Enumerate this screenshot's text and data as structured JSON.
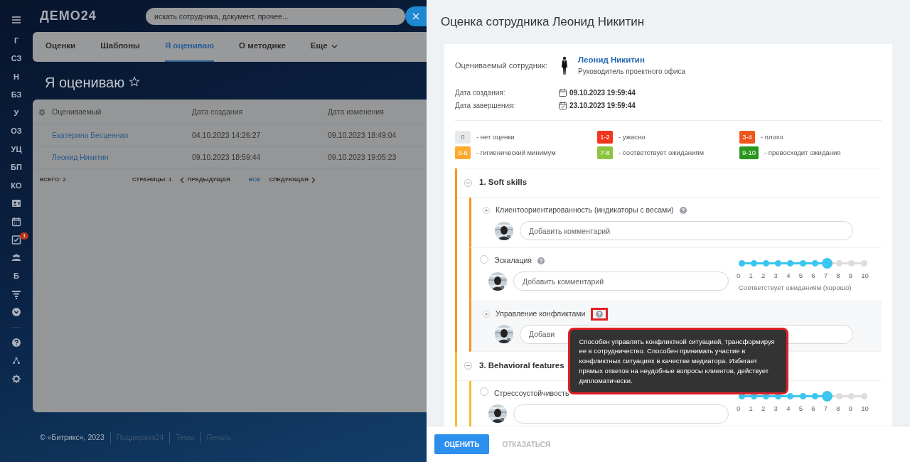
{
  "app": {
    "logo": "ДЕМО24",
    "search": {
      "placeholder": "искать сотрудника, документ, прочее..."
    }
  },
  "sidebar": [
    {
      "kind": "menu"
    },
    {
      "kind": "letter",
      "label": "Г"
    },
    {
      "kind": "letter",
      "label": "СЗ"
    },
    {
      "kind": "letter",
      "label": "Н"
    },
    {
      "kind": "letter",
      "label": "БЗ"
    },
    {
      "kind": "letter",
      "label": "У"
    },
    {
      "kind": "letter",
      "label": "ОЗ"
    },
    {
      "kind": "letter",
      "label": "УЦ"
    },
    {
      "kind": "letter",
      "label": "БП"
    },
    {
      "kind": "letter",
      "label": "КО"
    },
    {
      "kind": "icon"
    },
    {
      "kind": "icon"
    },
    {
      "kind": "icon",
      "badge": "1"
    },
    {
      "kind": "icon"
    },
    {
      "kind": "letter",
      "label": "Б"
    },
    {
      "kind": "icon"
    },
    {
      "kind": "icon"
    },
    {
      "kind": "divider"
    },
    {
      "kind": "icon"
    },
    {
      "kind": "icon"
    },
    {
      "kind": "icon"
    }
  ],
  "tabs": [
    {
      "label": "Оценки",
      "selected": false,
      "kind": "link"
    },
    {
      "label": "Шаблоны",
      "selected": false,
      "kind": "link"
    },
    {
      "label": "Я оцениваю",
      "selected": true,
      "kind": "link"
    },
    {
      "label": "О методике",
      "selected": false,
      "kind": "link"
    },
    {
      "label": "Еще",
      "selected": false,
      "kind": "dropdown"
    }
  ],
  "page_title": "Я оцениваю",
  "table": {
    "columns": [
      "Оцениваемый",
      "Дата создания",
      "Дата изменения"
    ],
    "rows": [
      {
        "cells": [
          "Екатерина Бесценная",
          "04.10.2023 14:26:27",
          "09.10.2023 18:49:04"
        ]
      },
      {
        "cells": [
          "Леонид Никитин",
          "09.10.2023 18:59:44",
          "09.10.2023 19:05:23"
        ]
      }
    ],
    "footer": {
      "total": "ВСЕГО: 2",
      "pages": "СТРАНИЦЫ: 1",
      "prev": "ПРЕДЫДУЩАЯ",
      "all": "ВСЕ",
      "next": "СЛЕДУЮЩАЯ"
    }
  },
  "footer_links": [
    {
      "kind": "text",
      "label": "© «Битрикс», 2023"
    },
    {
      "kind": "link",
      "label": "Поддержка24"
    },
    {
      "kind": "link",
      "label": "Темы"
    },
    {
      "kind": "link",
      "label": "Печать"
    }
  ],
  "panel": {
    "title": "Оценка сотрудника Леонид Никитин",
    "employee": {
      "label": "Оцениваемый сотрудник:",
      "name": "Леонид Никитин",
      "position": "Руководитель проектного офиса"
    },
    "dates": [
      {
        "label": "Дата создания:",
        "value": "09.10.2023 19:59:44",
        "kind": "created"
      },
      {
        "label": "Дата завершения:",
        "value": "23.10.2023 19:59:44",
        "kind": "due"
      }
    ],
    "legend": [
      {
        "badge": "0",
        "label": "- нет оценки",
        "color": "#e5e9ec"
      },
      {
        "badge": "1-2",
        "label": "- ужасно",
        "color": "#f1361b"
      },
      {
        "badge": "3-4",
        "label": "- плохо",
        "color": "#f0561a"
      },
      {
        "badge": "5-6",
        "label": "- гигиенический минимум",
        "color": "#ffa92e"
      },
      {
        "badge": "7-8",
        "label": "- соответствует ожиданиям",
        "color": "#8bc53f"
      },
      {
        "badge": "9-10",
        "label": "- превосходит ожидания",
        "color": "#2a981e"
      }
    ],
    "sections": [
      {
        "title": "1. Soft skills",
        "color": "#f7941d",
        "expanded": true,
        "items": [
          {
            "kind": "group",
            "title": "Клиентоориентированность (индикаторы с весами)",
            "help": true,
            "highlighted": false,
            "comment": {
              "placeholder": "Добавить комментарий"
            }
          },
          {
            "kind": "rated",
            "title": "Эскалация",
            "help": true,
            "highlighted": false,
            "comment": {
              "placeholder": "Добавить комментарий"
            },
            "level": 0.7,
            "ticks": [
              "0",
              "1",
              "2",
              "3",
              "4",
              "5",
              "6",
              "7",
              "8",
              "9",
              "10"
            ],
            "caption": "Соответствует ожиданиям (хорошо)"
          },
          {
            "kind": "group",
            "title": "Управление конфликтами",
            "help": true,
            "highlighted": true,
            "comment": {
              "placeholder": "Добави"
            },
            "tooltip": "Способен управлять конфликтной ситуацией, трансформируя ее в сотрудничество. Способен принимать участие в конфликтных ситуациях в качестве медиатора. Избегает прямых ответов на неудобные вопросы клиентов, действует дипломатически."
          }
        ]
      },
      {
        "title": "3. Behavioral features",
        "color": "#fbbc2c",
        "expanded": true,
        "items": [
          {
            "kind": "rated",
            "title": "Стрессоустойчивость",
            "help": false,
            "highlighted": false,
            "level": 0.7,
            "ticks": [
              "0",
              "1",
              "2",
              "3",
              "4",
              "5",
              "6",
              "7",
              "8",
              "9",
              "10"
            ]
          }
        ]
      }
    ],
    "actions": [
      {
        "label": "ОЦЕНИТЬ",
        "kind": "primary"
      },
      {
        "label": "ОТКАЗАТЬСЯ",
        "kind": "link"
      }
    ]
  }
}
